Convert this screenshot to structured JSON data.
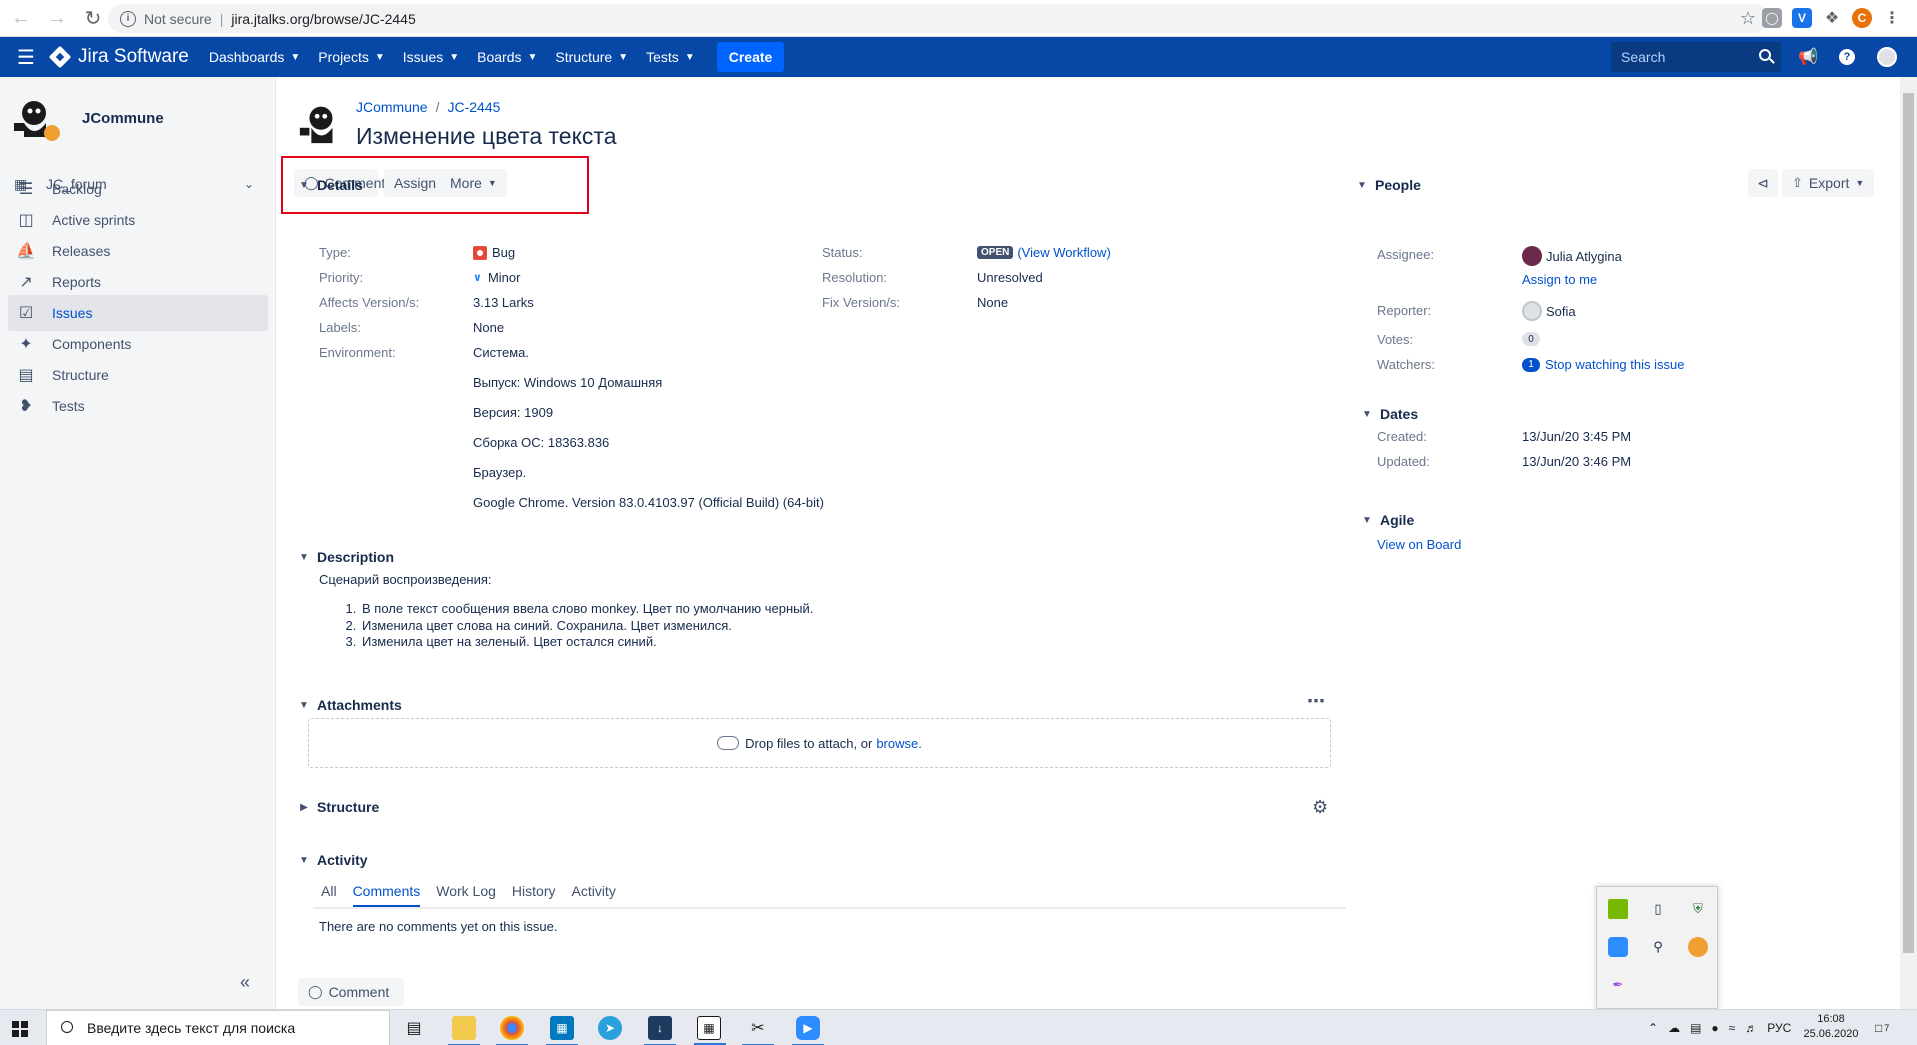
{
  "browser": {
    "security_label": "Not secure",
    "url": "jira.jtalks.org/browse/JC-2445",
    "profile_initial": "C"
  },
  "nav": {
    "brand": "Jira Software",
    "menus": [
      {
        "label": "Dashboards"
      },
      {
        "label": "Projects"
      },
      {
        "label": "Issues"
      },
      {
        "label": "Boards"
      },
      {
        "label": "Structure"
      },
      {
        "label": "Tests"
      }
    ],
    "create_label": "Create",
    "search_placeholder": "Search"
  },
  "sidebar": {
    "project_name": "JCommune",
    "board_name": "JC_forum",
    "items": [
      {
        "label": "Backlog",
        "icon": "backlog-icon"
      },
      {
        "label": "Active sprints",
        "icon": "board-icon"
      },
      {
        "label": "Releases",
        "icon": "ship-icon"
      },
      {
        "label": "Reports",
        "icon": "chart-icon"
      },
      {
        "label": "Issues",
        "icon": "issues-icon",
        "active": true
      },
      {
        "label": "Components",
        "icon": "puzzle-icon"
      },
      {
        "label": "Structure",
        "icon": "structure-icon"
      },
      {
        "label": "Tests",
        "icon": "feather-icon"
      }
    ]
  },
  "issue": {
    "breadcrumb_project": "JCommune",
    "breadcrumb_key": "JC-2445",
    "title": "Изменение цвета текста",
    "actions": {
      "comment": "Comment",
      "assign": "Assign",
      "more": "More",
      "export": "Export"
    },
    "details": {
      "heading": "Details",
      "type_label": "Type:",
      "type_value": "Bug",
      "priority_label": "Priority:",
      "priority_value": "Minor",
      "affects_label": "Affects Version/s:",
      "affects_value": "3.13 Larks",
      "labels_label": "Labels:",
      "labels_value": "None",
      "environment_label": "Environment:",
      "environment_lines": [
        "Система.",
        "Выпуск: Windows 10 Домашняя",
        "Версия: 1909",
        "Сборка ОС: 18363.836",
        "Браузер.",
        "Google Chrome. Version 83.0.4103.97 (Official Build) (64-bit)"
      ],
      "status_label": "Status:",
      "status_value": "OPEN",
      "workflow_link": "(View Workflow)",
      "resolution_label": "Resolution:",
      "resolution_value": "Unresolved",
      "fix_label": "Fix Version/s:",
      "fix_value": "None"
    },
    "description": {
      "heading": "Description",
      "intro": "Сценарий воспроизведения:",
      "steps": [
        "В поле текст сообщения ввела слово monkey. Цвет по умолчанию черный.",
        "Изменила цвет слова на синий. Сохранила. Цвет изменился.",
        "Изменила цвет на зеленый. Цвет остался синий."
      ]
    },
    "attachments": {
      "heading": "Attachments",
      "drop_text": "Drop files to attach, or ",
      "browse_link": "browse."
    },
    "structure_heading": "Structure",
    "activity": {
      "heading": "Activity",
      "tabs": [
        "All",
        "Comments",
        "Work Log",
        "History",
        "Activity"
      ],
      "active_tab": "Comments",
      "empty_text": "There are no comments yet on this issue.",
      "comment_button": "Comment"
    },
    "people": {
      "heading": "People",
      "assignee_label": "Assignee:",
      "assignee": "Julia Atlygina",
      "assign_to_me": "Assign to me",
      "reporter_label": "Reporter:",
      "reporter": "Sofia",
      "votes_label": "Votes:",
      "votes": "0",
      "watchers_label": "Watchers:",
      "watchers": "1",
      "watch_link": "Stop watching this issue"
    },
    "dates": {
      "heading": "Dates",
      "created_label": "Created:",
      "created": "13/Jun/20 3:45 PM",
      "updated_label": "Updated:",
      "updated": "13/Jun/20 3:46 PM"
    },
    "agile": {
      "heading": "Agile",
      "link": "View on Board"
    }
  },
  "taskbar": {
    "search_placeholder": "Введите здесь текст для поиска",
    "language": "РУС",
    "time": "16:08",
    "date": "25.06.2020",
    "notification_count": "7"
  },
  "colors": {
    "nav_bg": "#0747a6",
    "link": "#0052cc",
    "highlight_box": "#e3001b",
    "bug": "#e5493a"
  }
}
